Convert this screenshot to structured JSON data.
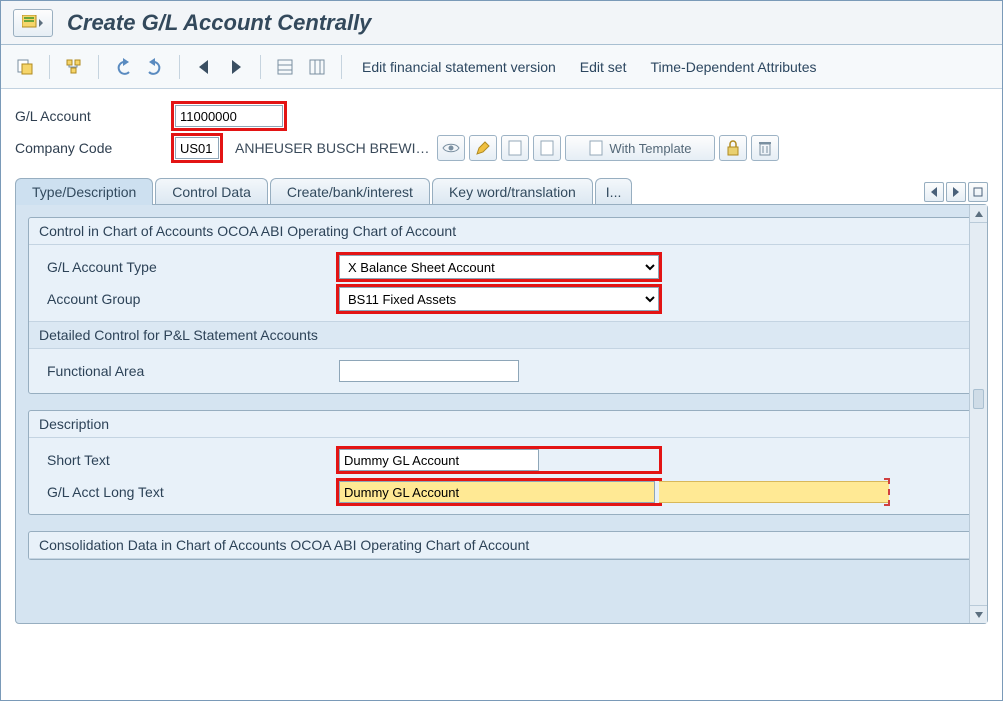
{
  "title": "Create G/L Account Centrally",
  "toolbar_links": {
    "edit_fsv": "Edit financial statement version",
    "edit_set": "Edit set",
    "time_dep": "Time-Dependent Attributes"
  },
  "header": {
    "gl_account_label": "G/L Account",
    "gl_account_value": "11000000",
    "company_code_label": "Company Code",
    "company_code_value": "US01",
    "company_desc": "ANHEUSER BUSCH BREWI…",
    "with_template_label": "With Template"
  },
  "tabs": {
    "type_desc": "Type/Description",
    "control_data": "Control Data",
    "create_bank": "Create/bank/interest",
    "key_word": "Key word/translation",
    "info": "I..."
  },
  "groups": {
    "coa_header": "Control in Chart of Accounts OCOA ABI Operating Chart of Account",
    "gl_type_label": "G/L Account Type",
    "gl_type_value": "X Balance Sheet Account",
    "acct_group_label": "Account Group",
    "acct_group_value": "BS11 Fixed Assets",
    "pnl_subheader": "Detailed Control for P&L Statement Accounts",
    "func_area_label": "Functional Area",
    "func_area_value": "",
    "desc_header": "Description",
    "short_text_label": "Short Text",
    "short_text_value": "Dummy GL Account",
    "long_text_label": "G/L Acct Long Text",
    "long_text_value": "Dummy GL Account",
    "consol_header": "Consolidation Data in Chart of Accounts OCOA ABI Operating Chart of Account"
  }
}
